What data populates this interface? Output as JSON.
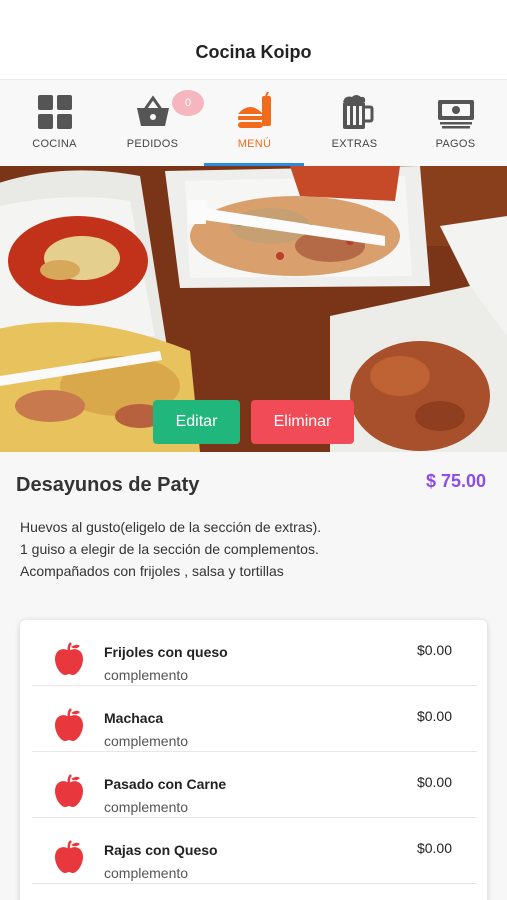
{
  "header": {
    "title": "Cocina Koipo"
  },
  "tabs": [
    {
      "label": "COCINA",
      "icon": "grid-icon"
    },
    {
      "label": "PEDIDOS",
      "icon": "basket-icon",
      "badge": "0"
    },
    {
      "label": "MENÚ",
      "icon": "burger-drink-icon",
      "active": true
    },
    {
      "label": "EXTRAS",
      "icon": "beer-mug-icon"
    },
    {
      "label": "PAGOS",
      "icon": "money-icon"
    }
  ],
  "product": {
    "name": "Desayunos de Paty",
    "price": "$ 75.00",
    "description": [
      "Huevos al gusto(eligelo de la sección de extras).",
      "1 guiso a elegir de la sección de complementos.",
      "Acompañados con frijoles , salsa y tortillas"
    ],
    "edit_label": "Editar",
    "delete_label": "Eliminar"
  },
  "complements": [
    {
      "name": "Frijoles con queso",
      "type": "complemento",
      "price": "$0.00",
      "icon": "apple-icon"
    },
    {
      "name": "Machaca",
      "type": "complemento",
      "price": "$0.00",
      "icon": "apple-icon"
    },
    {
      "name": "Pasado con Carne",
      "type": "complemento",
      "price": "$0.00",
      "icon": "apple-icon"
    },
    {
      "name": "Rajas con Queso",
      "type": "complemento",
      "price": "$0.00",
      "icon": "apple-icon"
    }
  ],
  "colors": {
    "accent_active": "#f26b1d",
    "price": "#8c4de8",
    "edit_button": "#21b67c",
    "delete_button": "#f04b57",
    "apple": "#e8383d",
    "tab_underline": "#2a8be0"
  }
}
